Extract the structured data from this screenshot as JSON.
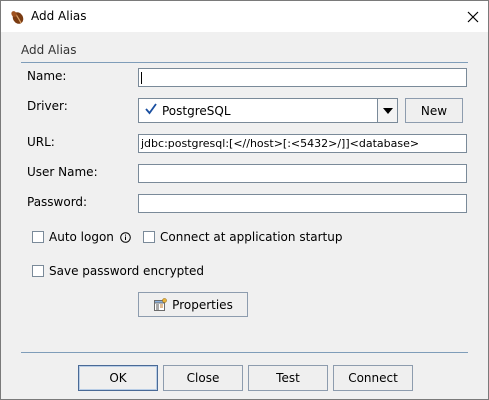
{
  "window": {
    "title": "Add Alias",
    "icons": {
      "app": "coffee-bean-icon",
      "close": "close-icon"
    }
  },
  "section": {
    "title": "Add Alias"
  },
  "form": {
    "name": {
      "label": "Name:",
      "value": ""
    },
    "driver": {
      "label": "Driver:",
      "selected": "PostgreSQL",
      "new_label": "New",
      "status_icon": "check-icon",
      "accent": "#1a4fa0"
    },
    "url": {
      "label": "URL:",
      "value": "jdbc:postgresql:[<//host>[:<5432>/]]<database>"
    },
    "user_name": {
      "label": "User Name:",
      "value": ""
    },
    "password": {
      "label": "Password:",
      "value": ""
    },
    "auto_logon": {
      "label": "Auto logon",
      "checked": false,
      "info_icon": "info-icon"
    },
    "connect_startup": {
      "label": "Connect at application startup",
      "checked": false
    },
    "save_password": {
      "label": "Save password encrypted",
      "checked": false
    },
    "properties": {
      "label": "Properties",
      "icon": "properties-icon"
    }
  },
  "footer": {
    "ok": "OK",
    "close": "Close",
    "test": "Test",
    "connect": "Connect"
  }
}
